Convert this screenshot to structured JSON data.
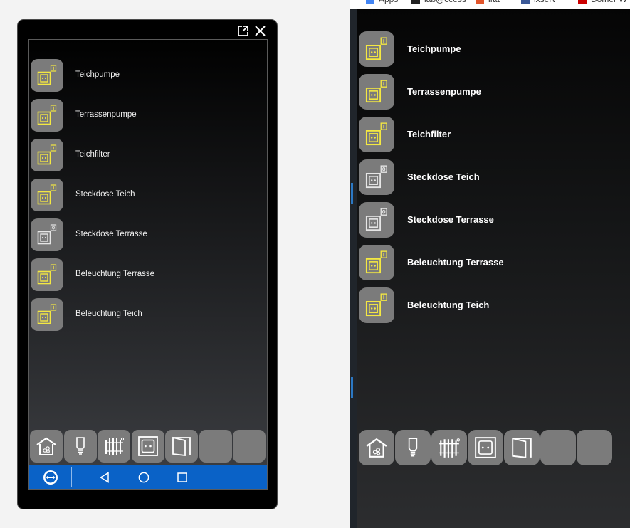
{
  "devices": [
    {
      "label": "Teichpumpe",
      "state": "on"
    },
    {
      "label": "Terrassenpumpe",
      "state": "on"
    },
    {
      "label": "Teichfilter",
      "state": "on"
    },
    {
      "label": "Steckdose Teich",
      "state": "on"
    },
    {
      "label": "Steckdose Terrasse",
      "state": "off"
    },
    {
      "label": "Beleuchtung Terrasse",
      "state": "on"
    },
    {
      "label": "Beleuchtung Teich",
      "state": "on"
    }
  ],
  "right_devices": [
    {
      "label": "Teichpumpe",
      "state": "on"
    },
    {
      "label": "Terrassenpumpe",
      "state": "on"
    },
    {
      "label": "Teichfilter",
      "state": "on"
    },
    {
      "label": "Steckdose Teich",
      "state": "off"
    },
    {
      "label": "Steckdose Terrasse",
      "state": "off"
    },
    {
      "label": "Beleuchtung Terrasse",
      "state": "on"
    },
    {
      "label": "Beleuchtung Teich",
      "state": "on"
    }
  ],
  "dock": [
    "house-icon",
    "bulb-icon",
    "radiator-icon",
    "socket-icon",
    "door-icon",
    "empty",
    "empty"
  ],
  "bookmarks": [
    "Apps",
    "lab@ccess",
    "ifttt",
    "ixserv",
    "Domer W"
  ],
  "colors": {
    "on": "#f4e842",
    "off": "#e6e6e6",
    "tile": "#7b7b7b",
    "navbar": "#0a62c7"
  }
}
